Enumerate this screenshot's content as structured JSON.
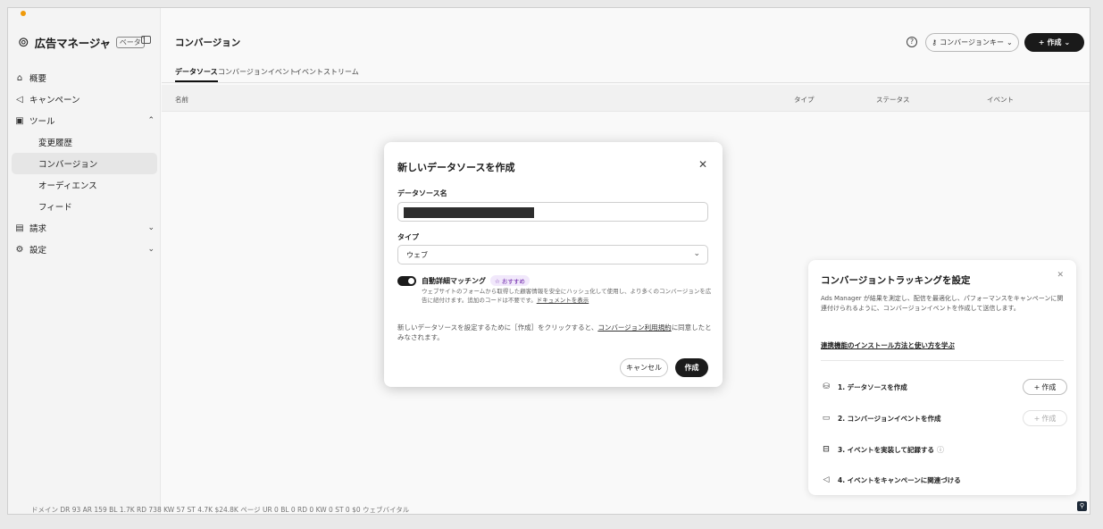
{
  "sidebar": {
    "brand_icon": "meta-logo-icon",
    "app_name": "広告マネージャ",
    "beta_label": "ベータ",
    "items": [
      {
        "label": "概要",
        "icon": "home-icon"
      },
      {
        "label": "キャンペーン",
        "icon": "megaphone-icon"
      },
      {
        "label": "ツール",
        "icon": "toolbox-icon",
        "expanded": true
      },
      {
        "label": "変更履歴"
      },
      {
        "label": "コンバージョン",
        "active": true
      },
      {
        "label": "オーディエンス"
      },
      {
        "label": "フィード"
      },
      {
        "label": "請求",
        "icon": "billing-icon",
        "expanded": false
      },
      {
        "label": "設定",
        "icon": "settings-icon",
        "expanded": false
      }
    ]
  },
  "header": {
    "title": "コンバージョン",
    "conversion_key_label": "コンバージョンキー",
    "create_label": "作成"
  },
  "tabs": [
    {
      "label": "データソース",
      "active": true
    },
    {
      "label": "コンバージョンイベント"
    },
    {
      "label": "イベントストリーム"
    }
  ],
  "table": {
    "columns": [
      "名前",
      "タイプ",
      "ステータス",
      "イベント"
    ]
  },
  "modal": {
    "title": "新しいデータソースを作成",
    "name_label": "データソース名",
    "name_value": "[redacted]",
    "type_label": "タイプ",
    "type_value": "ウェブ",
    "matching_title": "自動詳細マッチング",
    "matching_badge": "おすすめ",
    "matching_enabled": true,
    "matching_desc": "ウェブサイトのフォームから取得した顧客情報を安全にハッシュ化して使用し、より多くのコンバージョンを広告に紐付けます。追加のコードは不要です。",
    "matching_link": "ドキュメントを表示",
    "consent_pre": "新しいデータソースを設定するために［作成］をクリックすると、",
    "consent_link": "コンバージョン利用規約",
    "consent_post": "に同意したとみなされます。",
    "cancel_label": "キャンセル",
    "submit_label": "作成"
  },
  "setup_panel": {
    "title": "コンバージョントラッキングを設定",
    "description": "Ads Manager が結果を測定し、配信を最適化し、パフォーマンスをキャンペーンに関連付けられるように、コンバージョンイベントを作成して送信します。",
    "learn_link": "連携機能のインストール方法と使い方を学ぶ",
    "steps": [
      {
        "label": "1. データソースを作成",
        "icon": "datasource-icon",
        "button": "作成"
      },
      {
        "label": "2. コンバージョンイベントを作成",
        "icon": "calendar-icon",
        "button": "作成"
      },
      {
        "label": "3. イベントを実装して記録する",
        "icon": "code-icon"
      },
      {
        "label": "4. イベントをキャンペーンに関連づける",
        "icon": "megaphone-icon"
      }
    ]
  },
  "footer": {
    "text": "ドメイン DR 93 AR 159 BL 1.7K RD 738 KW 57 ST 4.7K $24.8K ページ UR 0 BL 0 RD 0 KW 0 ST 0 $0 ウェブバイタル"
  },
  "colors": {
    "primary_button": "#1b1b1b",
    "badge_text": "#6b21a8",
    "badge_bg": "#f1e8fb"
  }
}
